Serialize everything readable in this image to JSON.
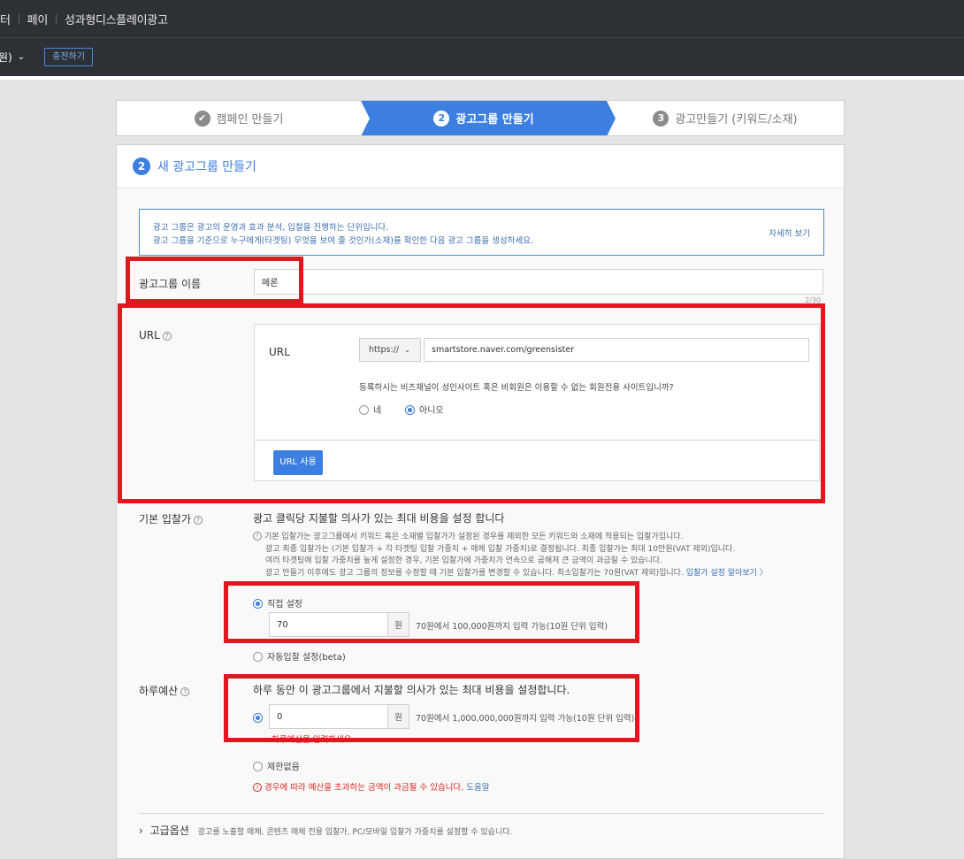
{
  "topnav": {
    "items": [
      "터",
      "페이",
      "성과형디스플레이광고"
    ]
  },
  "subnav": {
    "account": "원)",
    "charge_label": "충전하기"
  },
  "steps": [
    {
      "num": "✔",
      "label": "캠페인 만들기"
    },
    {
      "num": "2",
      "label": "광고그룹 만들기"
    },
    {
      "num": "3",
      "label": "광고만들기 (키워드/소재)"
    }
  ],
  "panel": {
    "num": "2",
    "title": "새 광고그룹 만들기"
  },
  "info": {
    "line1": "광고 그룹은 광고의 운영과 효과 분석, 입찰을 진행하는 단위입니다.",
    "line2": "광고 그룹을 기준으로 누구에게(타겟팅) 무엇을 보여 줄 것인가(소재)를 확인한 다음 광고 그룹을 생성하세요.",
    "more": "자세히 보기"
  },
  "group_name": {
    "label": "광고그룹 이름",
    "value": "메론",
    "counter": "2/30"
  },
  "url": {
    "label": "URL",
    "help": "?",
    "inner_label": "URL",
    "protocol": "https://",
    "value": "smartstore.naver.com/greensister",
    "question": "등록하시는 비즈채널이 성인사이트 혹은 비회원은 이용할 수 없는 회원전용 사이트입니까?",
    "yes": "네",
    "no": "아니오",
    "use_button": "URL 사용"
  },
  "bid": {
    "label": "기본 입찰가",
    "desc": "광고 클릭당 지불할 의사가 있는 최대 비용을 설정 합니다",
    "note1": "기본 입찰가는 광고그룹에서 키워드 혹은 소재별 입찰가가 설정된 경우를 제외한 모든 키워드와 소재에 적용되는 입찰가입니다.",
    "note2": "광고 최종 입찰가는 (기본 입찰가 + 각 타겟팅 입찰 가중치 + 매체 입찰 가중치)로 결정됩니다. 최종 입찰가는 최대 10만원(VAT 제외)입니다.",
    "note3": "여러 타겟팅에 입찰 가중치를 높게 설정한 경우, 기본 입찰가에 가중치가 연속으로 곱해져 큰 금액이 과금될 수 있습니다.",
    "note4": "광고 만들기 이후에도 광고 그룹의 정보를 수정할 때 기본 입찰가를 변경할 수 있습니다. 최소입찰가는 70원(VAT 제외)입니다.",
    "note_link": "입찰가 설정 알아보기 〉",
    "manual": "직접 설정",
    "value": "70",
    "unit": "원",
    "range": "70원에서 100,000원까지 입력 가능(10원 단위 입력)",
    "auto": "자동입찰 설정(beta)"
  },
  "budget": {
    "label": "하루예산",
    "desc": "하루 동안 이 광고그룹에서 지불할 의사가 있는 최대 비용을 설정합니다.",
    "value": "0",
    "unit": "원",
    "range": "70원에서 1,000,000,000원까지 입력 가능(10원 단위 입력)",
    "error": "하루예산을 입력하세요.",
    "unlimited": "제한없음",
    "warning": "경우에 따라 예산을 초과하는 금액이 과금될 수 있습니다.",
    "help_link": "도움말"
  },
  "advanced": {
    "label": "고급옵션",
    "desc": "광고를 노출할 매체, 콘텐츠 매체 전용 입찰가, PC/모바일 입찰가 가중치를 설정할 수 있습니다."
  },
  "colors": {
    "accent": "#3d7fe0",
    "highlight": "#e0171f",
    "nav_bg": "#2d3035"
  }
}
